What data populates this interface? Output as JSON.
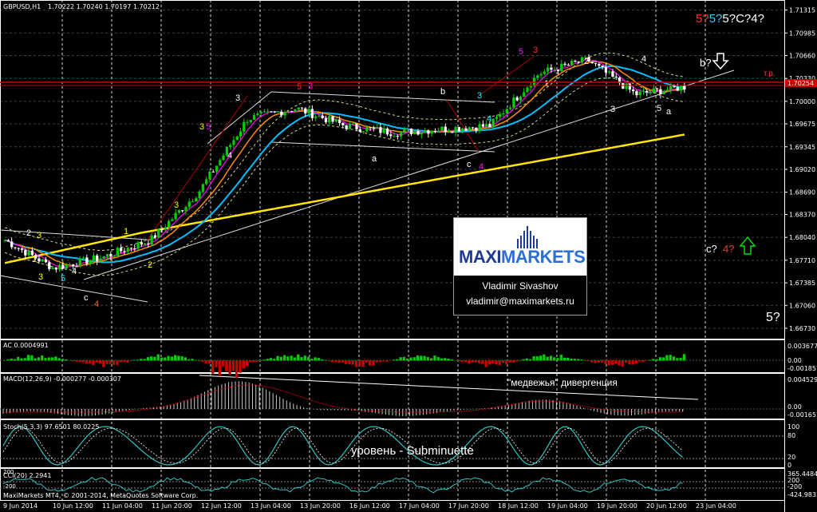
{
  "header": {
    "symbol": "GBPUSD,H1",
    "quote": "1.70222 1.70240 1.70197 1.70212"
  },
  "price_scale": {
    "ticks": [
      "1.71315",
      "1.70985",
      "1.70660",
      "1.70330",
      "1.70000",
      "1.69675",
      "1.69345",
      "1.69020",
      "1.68690",
      "1.68370",
      "1.68040",
      "1.67710",
      "1.67385",
      "1.67060",
      "1.66730"
    ],
    "current": "1.70254"
  },
  "tp_label": "т.р.",
  "wave_count_top": [
    {
      "text": "5?",
      "color": "#ff3333"
    },
    {
      "text": "5?",
      "color": "#33ccff"
    },
    {
      "text": "5?",
      "color": "#ffffff"
    },
    {
      "text": "C?",
      "color": "#ffffff"
    },
    {
      "text": "4?",
      "color": "#ffffff"
    }
  ],
  "annotations": {
    "b_label": "b?",
    "c_label": "c?",
    "c_four": "4?",
    "five_label": "5?",
    "bearish_divergence": "\"медвежья\" дивергенция",
    "subminuette": "уровень - Subminuette"
  },
  "logo": {
    "brand_part1": "MAXI",
    "brand_part2": "MARKETS",
    "name": "Vladimir Sivashov",
    "email": "vladimir@maximarkets.ru"
  },
  "indicators": {
    "ac": {
      "label": "AC 0.0004991",
      "ticks": [
        "0.003677",
        "0.00",
        "-0.001857"
      ]
    },
    "macd": {
      "label": "MACD(12,26,9) -0.000277 -0.000307",
      "ticks": [
        "0.004529",
        "0.00",
        "-0.001657"
      ]
    },
    "stoch": {
      "label": "Stoch(5,3,3) 97.6501 80.0225",
      "ticks": [
        "100",
        "80",
        "20",
        "0"
      ]
    },
    "cci": {
      "label": "CCI(20) 2.2941",
      "ticks": [
        "365.4484",
        "200",
        "-200",
        "-424.9833"
      ],
      "left_ticks": [
        "200",
        "-200"
      ]
    }
  },
  "copyright": "MaxiMarkets MT4, © 2001-2014, MetaQuotes Software Corp.",
  "time_axis": [
    "9 Jun 2014",
    "10 Jun 12:00",
    "11 Jun 04:00",
    "11 Jun 20:00",
    "12 Jun 12:00",
    "13 Jun 04:00",
    "13 Jun 20:00",
    "16 Jun 12:00",
    "17 Jun 04:00",
    "17 Jun 20:00",
    "18 Jun 12:00",
    "19 Jun 04:00",
    "19 Jun 20:00",
    "20 Jun 12:00",
    "23 Jun 04:00"
  ],
  "chart_data": {
    "type": "candlestick",
    "symbol": "GBPUSD",
    "timeframe": "H1",
    "ylim": [
      1.6658,
      1.7146
    ],
    "close_approx": [
      {
        "t": "9 Jun 2014",
        "y": 1.68
      },
      {
        "t": "10 Jun 12:00",
        "y": 1.676
      },
      {
        "t": "11 Jun 04:00",
        "y": 1.6775
      },
      {
        "t": "11 Jun 20:00",
        "y": 1.68
      },
      {
        "t": "12 Jun 12:00",
        "y": 1.687
      },
      {
        "t": "13 Jun 04:00",
        "y": 1.6975
      },
      {
        "t": "13 Jun 20:00",
        "y": 1.699
      },
      {
        "t": "16 Jun 12:00",
        "y": 1.6965
      },
      {
        "t": "17 Jun 04:00",
        "y": 1.6955
      },
      {
        "t": "17 Jun 20:00",
        "y": 1.696
      },
      {
        "t": "18 Jun 12:00",
        "y": 1.6965
      },
      {
        "t": "19 Jun 04:00",
        "y": 1.704
      },
      {
        "t": "19 Jun 20:00",
        "y": 1.706
      },
      {
        "t": "20 Jun 12:00",
        "y": 1.701
      },
      {
        "t": "23 Jun 04:00",
        "y": 1.7021
      }
    ],
    "resistance_line": 1.7025,
    "colors": {
      "bull": "#00cc00",
      "bear": "#ffffff",
      "ma_fast": "#ff00ff",
      "ma_mid": "#ff8c00",
      "ma_slow": "#00bfff",
      "ma_long": "#ffe600",
      "grid": "#ffffff"
    }
  }
}
